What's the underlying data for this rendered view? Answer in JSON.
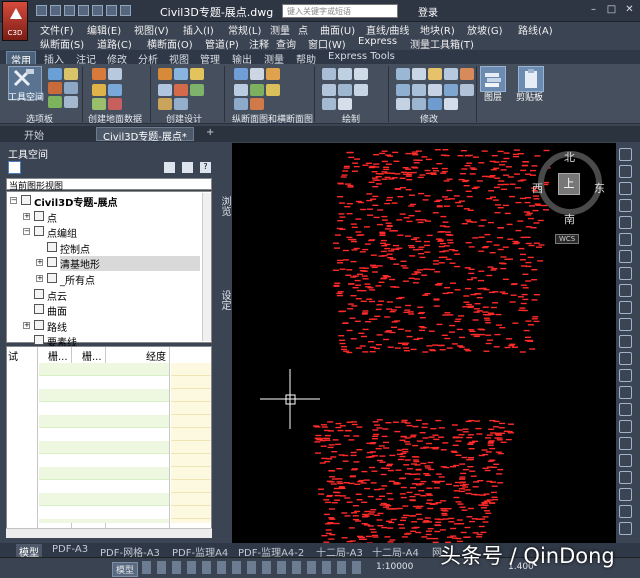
{
  "app": {
    "title": "Civil3D专题-展点.dwg",
    "search_placeholder": "键入关键字或短语",
    "login_label": "登录",
    "logo_label": "C3D"
  },
  "menu": {
    "row1": [
      "文件(F)",
      "编辑(E)",
      "视图(V)",
      "插入(I)",
      "常规(L)",
      "测量",
      "点",
      "曲面(U)",
      "直线/曲线",
      "地块(R)",
      "放坡(G)",
      "路线(A)"
    ],
    "row2": [
      "纵断面(S)",
      "道路(C)",
      "横断面(O)",
      "管道(P)",
      "注释",
      "查询",
      "窗口(W)",
      "Express",
      "测量工具箱(T)"
    ]
  },
  "ribbon": {
    "tabs": [
      "常用",
      "插入",
      "注记",
      "修改",
      "分析",
      "视图",
      "管理",
      "输出",
      "测量",
      "帮助",
      "Express Tools"
    ],
    "active_tab": "常用",
    "big_button_label": "工具空间",
    "panels": [
      "选项板",
      "创建地面数据",
      "创建设计",
      "纵断面图和横断面图",
      "绘制",
      "修改"
    ],
    "right_buttons": [
      "图层",
      "剪贴板"
    ]
  },
  "doc_tabs": {
    "start": "开始",
    "active": "Civil3D专题-展点*",
    "add": "+"
  },
  "toolspace": {
    "title": "工具空间",
    "view_select": "当前图形视图",
    "tree": [
      {
        "label": "Civil3D专题-展点",
        "level": 0,
        "bold": true,
        "expander": "−"
      },
      {
        "label": "点",
        "level": 1,
        "expander": "+"
      },
      {
        "label": "点编组",
        "level": 1,
        "expander": "−"
      },
      {
        "label": "控制点",
        "level": 2,
        "expander": ""
      },
      {
        "label": "清基地形",
        "level": 2,
        "expander": "+",
        "selected": true
      },
      {
        "label": "_所有点",
        "level": 2,
        "expander": "+"
      },
      {
        "label": "点云",
        "level": 1,
        "expander": ""
      },
      {
        "label": "曲面",
        "level": 1,
        "expander": ""
      },
      {
        "label": "路线",
        "level": 1,
        "expander": "+"
      },
      {
        "label": "要素线",
        "level": 1,
        "expander": ""
      }
    ],
    "grid_headers": [
      "试",
      "栅...",
      "栅...",
      "经度"
    ],
    "side_tabs": [
      "浏览",
      "设定"
    ]
  },
  "viewcube": {
    "north": "北",
    "south": "南",
    "east": "东",
    "west": "西",
    "top": "上",
    "wcs": "WCS"
  },
  "layout_tabs": [
    "模型",
    "PDF-A3",
    "PDF-网格-A3",
    "PDF-监理A4",
    "PDF-监理A4-2",
    "十二局-A3",
    "十二局-A4",
    "网"
  ],
  "status": {
    "model": "模型",
    "scale": "1:10000",
    "value": "1.400"
  },
  "watermark": "头条号 / QinDong",
  "colors": {
    "accent": "#4d6178",
    "point_marker": "#ff2a2a",
    "canvas": "#000000"
  }
}
